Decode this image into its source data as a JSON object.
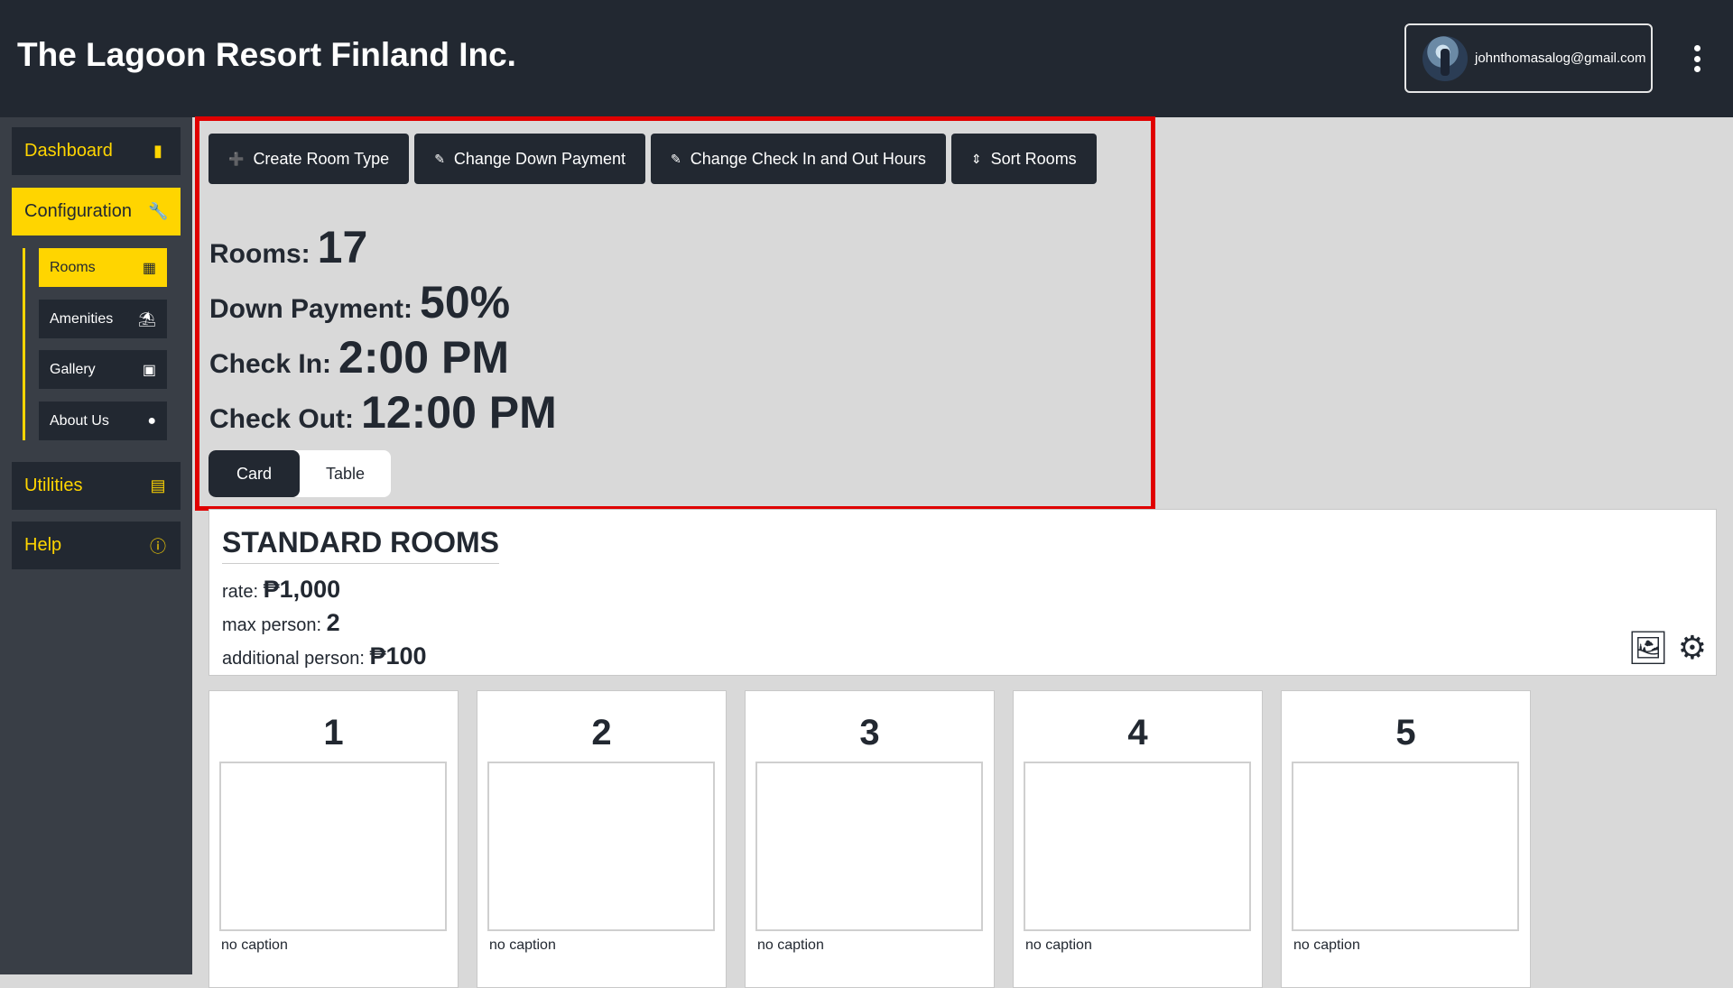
{
  "header": {
    "brand": "The Lagoon Resort Finland Inc.",
    "user_email": "johnthomasalog@gmail.com"
  },
  "sidebar": {
    "items": [
      {
        "label": "Dashboard",
        "icon": "bar-chart-icon"
      },
      {
        "label": "Configuration",
        "icon": "wrench-icon",
        "active": true
      },
      {
        "label": "Utilities",
        "icon": "server-icon"
      },
      {
        "label": "Help",
        "icon": "help-circle-icon"
      }
    ],
    "sub_items": [
      {
        "label": "Rooms",
        "icon": "building-icon",
        "active": true
      },
      {
        "label": "Amenities",
        "icon": "umbrella-beach-icon"
      },
      {
        "label": "Gallery",
        "icon": "camera-icon"
      },
      {
        "label": "About Us",
        "icon": "location-pin-icon"
      }
    ]
  },
  "toolbar": {
    "create_room_type": "Create Room Type",
    "change_down_payment": "Change Down Payment",
    "change_check_hours": "Change Check In and Out Hours",
    "sort_rooms": "Sort Rooms"
  },
  "stats": {
    "rooms_label": "Rooms:",
    "rooms_value": "17",
    "down_payment_label": "Down Payment:",
    "down_payment_value": "50%",
    "check_in_label": "Check In:",
    "check_in_value": "2:00 PM",
    "check_out_label": "Check Out:",
    "check_out_value": "12:00 PM"
  },
  "view_toggle": {
    "card": "Card",
    "table": "Table",
    "selected": "Card"
  },
  "room_type": {
    "title": "STANDARD ROOMS",
    "rate_label": "rate:",
    "rate_value": "₱1,000",
    "max_person_label": "max person:",
    "max_person_value": "2",
    "additional_label": "additional person:",
    "additional_value": "₱100"
  },
  "rooms": [
    {
      "number": "1",
      "caption": "no caption"
    },
    {
      "number": "2",
      "caption": "no caption"
    },
    {
      "number": "3",
      "caption": "no caption"
    },
    {
      "number": "4",
      "caption": "no caption"
    },
    {
      "number": "5",
      "caption": "no caption"
    }
  ],
  "colors": {
    "dark": "#222831",
    "sidebar": "#393e46",
    "accent": "#ffd500",
    "highlight": "#e00000",
    "background": "#d9d9d9"
  }
}
